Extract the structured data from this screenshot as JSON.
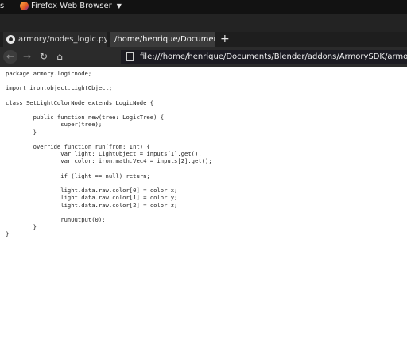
{
  "topbar": {
    "activities": "s",
    "app_name": "Firefox Web Browser",
    "app_icon": "firefox-icon"
  },
  "tabs": [
    {
      "label": "armory/nodes_logic.py a",
      "icon": "github-icon"
    },
    {
      "label": "/home/henrique/Documents",
      "active": true
    }
  ],
  "nav": {
    "url": "file:///home/henrique/Documents/Blender/addons/ArmorySDK/armory/Sources/armory/logicnode/SetLightColorNode.hx"
  },
  "document": {
    "lines": [
      "package armory.logicnode;",
      "",
      "import iron.object.LightObject;",
      "",
      "class SetLightColorNode extends LogicNode {",
      "",
      "\tpublic function new(tree: LogicTree) {",
      "\t\tsuper(tree);",
      "\t}",
      "",
      "\toverride function run(from: Int) {",
      "\t\tvar light: LightObject = inputs[1].get();",
      "\t\tvar color: iron.math.Vec4 = inputs[2].get();",
      "",
      "\t\tif (light == null) return;",
      "",
      "\t\tlight.data.raw.color[0] = color.x;",
      "\t\tlight.data.raw.color[1] = color.y;",
      "\t\tlight.data.raw.color[2] = color.z;",
      "",
      "\t\trunOutput(0);",
      "\t}",
      "}"
    ]
  },
  "colors": {
    "topbar_bg": "#121212",
    "tabbar_bg": "#1e1e1e",
    "active_tab_bg": "#3b3b3b",
    "navbar_bg": "#2b2b2b",
    "urlbar_bg": "#1c1b22"
  }
}
